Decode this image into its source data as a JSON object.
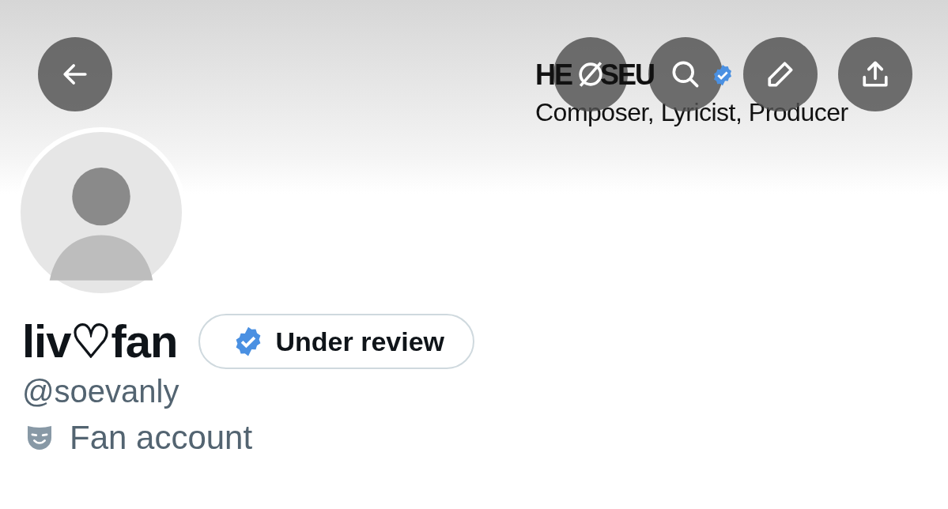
{
  "banner": {
    "title_parts": [
      "HE",
      "SEU"
    ],
    "subtitle": "Composer, Lyricist, Producer"
  },
  "header_buttons": [
    {
      "kind": "back"
    },
    {
      "kind": "hide"
    },
    {
      "kind": "search"
    },
    {
      "kind": "edit"
    },
    {
      "kind": "share"
    }
  ],
  "profile": {
    "display_name": "liv♡fan",
    "status_pill": "Under review",
    "handle": "@soevanly",
    "category": "Fan account"
  }
}
